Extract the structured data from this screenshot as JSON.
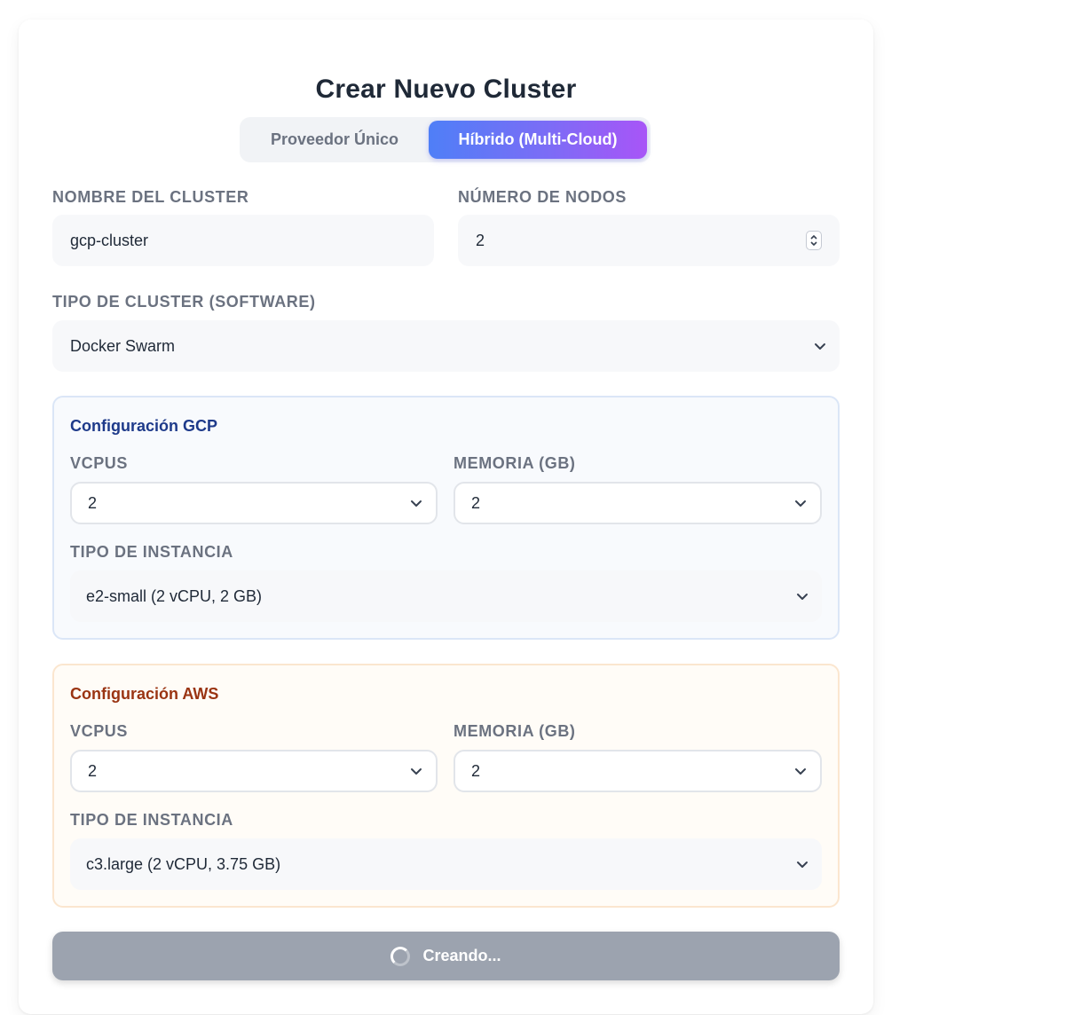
{
  "form": {
    "title": "Crear Nuevo Cluster",
    "mode_tabs": {
      "single": "Proveedor Único",
      "hybrid": "Híbrido (Multi-Cloud)",
      "selected": "hybrid"
    },
    "cluster_name": {
      "label": "NOMBRE DEL CLUSTER",
      "value": "gcp-cluster"
    },
    "node_count": {
      "label": "NÚMERO DE NODOS",
      "value": "2"
    },
    "cluster_type": {
      "label": "TIPO DE CLUSTER (SOFTWARE)",
      "value": "Docker Swarm"
    },
    "gcp": {
      "title": "Configuración GCP",
      "vcpus": {
        "label": "VCPUS",
        "value": "2"
      },
      "memory": {
        "label": "MEMORIA (GB)",
        "value": "2"
      },
      "instance": {
        "label": "TIPO DE INSTANCIA",
        "value": "e2-small (2 vCPU, 2 GB)"
      }
    },
    "aws": {
      "title": "Configuración AWS",
      "vcpus": {
        "label": "VCPUS",
        "value": "2"
      },
      "memory": {
        "label": "MEMORIA (GB)",
        "value": "2"
      },
      "instance": {
        "label": "TIPO DE INSTANCIA",
        "value": "c3.large (2 vCPU, 3.75 GB)"
      }
    },
    "submit": {
      "label": "Creando...",
      "icon": "spinner-icon"
    }
  },
  "colors": {
    "accent_start": "#4f7ff7",
    "accent_end": "#a855f7",
    "gcp_title": "#1e3a8a",
    "aws_title": "#9a3412",
    "button_disabled": "#9ca3af"
  }
}
